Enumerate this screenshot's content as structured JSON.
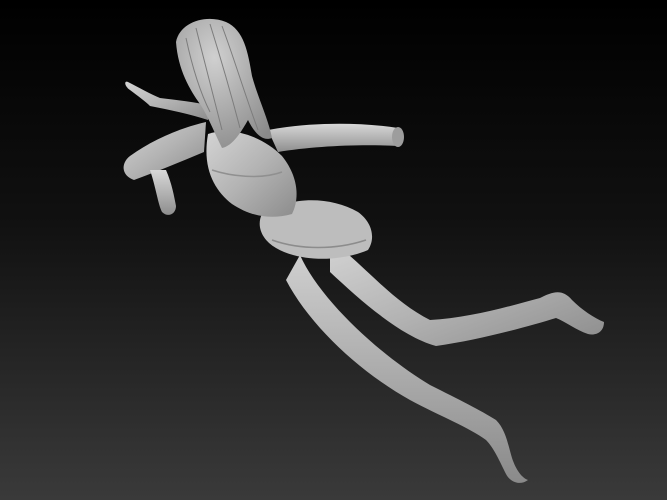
{
  "scene": {
    "background": {
      "top_color": "#000000",
      "bottom_color": "#3a3a3a"
    },
    "model": {
      "name": "swimming-figure-with-pool-noodle",
      "material_color": "#b9b9b9",
      "highlight_color": "#e2e2e2",
      "shadow_color": "#6e6e6e"
    }
  }
}
